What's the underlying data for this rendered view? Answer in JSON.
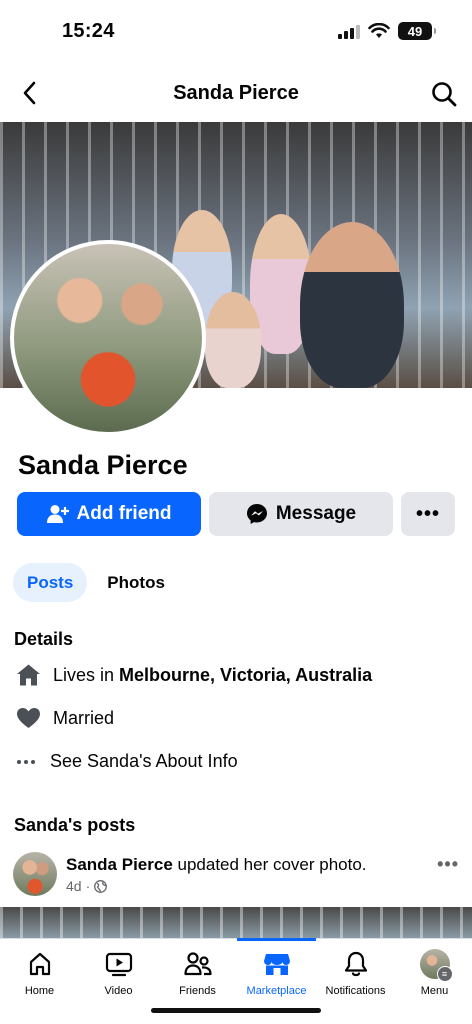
{
  "status_bar": {
    "time": "15:24",
    "battery": "49"
  },
  "header": {
    "title": "Sanda Pierce"
  },
  "profile": {
    "name": "Sanda Pierce",
    "add_friend_label": "Add friend",
    "message_label": "Message",
    "more_label": "•••"
  },
  "tabs": [
    {
      "label": "Posts",
      "active": true
    },
    {
      "label": "Photos",
      "active": false
    }
  ],
  "details": {
    "title": "Details",
    "lives_in_prefix": "Lives in",
    "lives_in_location": "Melbourne, Victoria, Australia",
    "relationship": "Married",
    "about_link": "See Sanda's About Info"
  },
  "posts_section": {
    "title": "Sanda's posts",
    "post": {
      "author": "Sanda Pierce",
      "action": " updated her cover photo.",
      "age": "4d",
      "separator": "·",
      "more_label": "•••"
    }
  },
  "bottom_nav": [
    {
      "label": "Home",
      "icon": "home-icon"
    },
    {
      "label": "Video",
      "icon": "video-icon"
    },
    {
      "label": "Friends",
      "icon": "friends-icon"
    },
    {
      "label": "Marketplace",
      "icon": "marketplace-icon",
      "active": true
    },
    {
      "label": "Notifications",
      "icon": "bell-icon"
    },
    {
      "label": "Menu",
      "icon": "menu-avatar"
    }
  ],
  "colors": {
    "accent": "#0866ff",
    "secondary_button": "#e4e6eb",
    "active_tab_bg": "#e7f0fd",
    "muted_text": "#65676b"
  }
}
